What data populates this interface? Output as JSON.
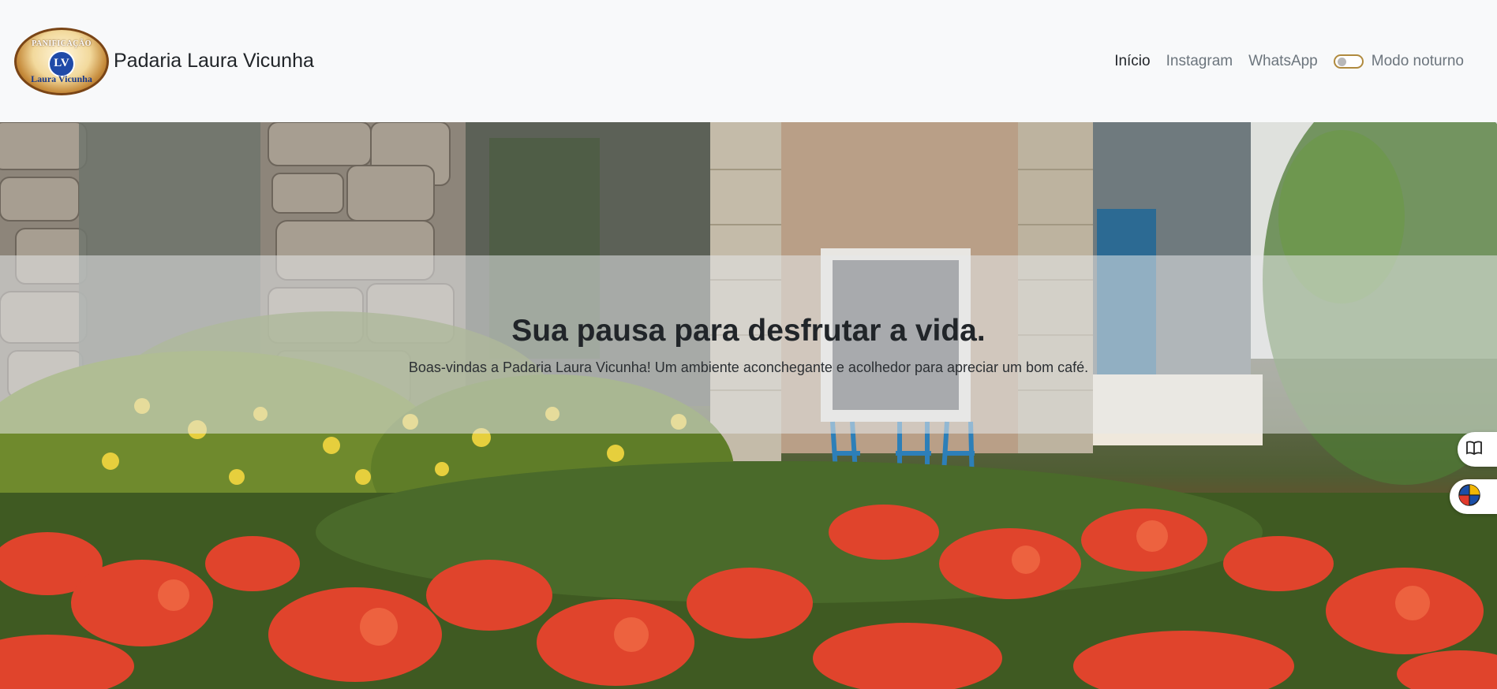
{
  "brand": {
    "name": "Padaria Laura Vicunha",
    "logo": {
      "top_text": "PANIFICAÇÃO",
      "monogram": "LV",
      "bottom_text": "Laura Vicunha"
    }
  },
  "nav": {
    "items": [
      {
        "label": "Início",
        "active": true
      },
      {
        "label": "Instagram",
        "active": false
      },
      {
        "label": "WhatsApp",
        "active": false
      }
    ],
    "dark_mode": {
      "label": "Modo noturno",
      "enabled": false
    }
  },
  "hero": {
    "title": "Sua pausa para desfrutar a vida.",
    "subtitle": "Boas-vindas a Padaria Laura Vicunha! Um ambiente aconchegante e acolhedor para apreciar um bom café."
  },
  "floating_buttons": [
    {
      "icon": "book-icon"
    },
    {
      "icon": "globe-icon"
    }
  ],
  "colors": {
    "navbar_bg": "#f8f9fa",
    "text_dark": "#212529",
    "text_muted": "#6c757d",
    "toggle_border": "#b08a3e"
  }
}
